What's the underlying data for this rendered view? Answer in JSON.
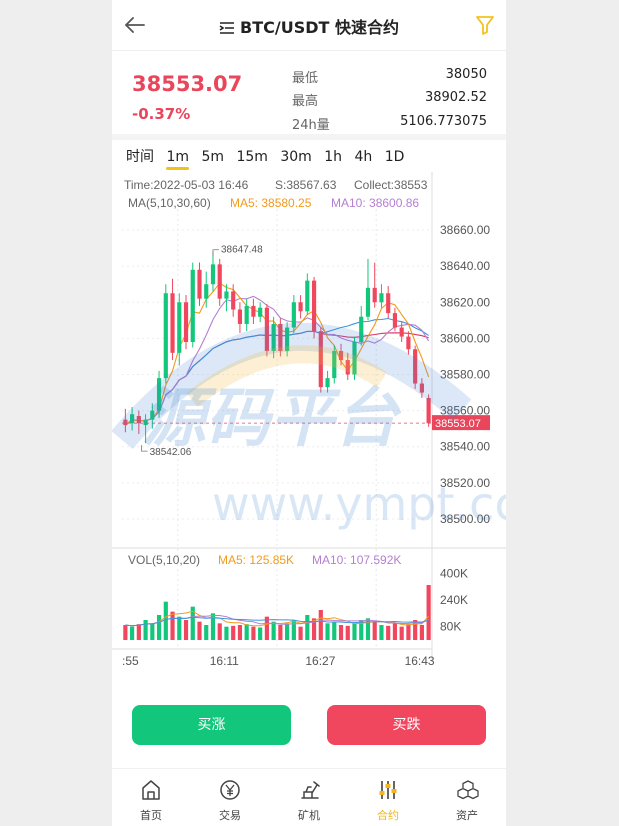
{
  "header": {
    "title": "BTC/USDT 快速合约"
  },
  "summary": {
    "price": "38553.07",
    "change": "-0.37%",
    "stats": [
      {
        "label": "最低",
        "value": "38050"
      },
      {
        "label": "最高",
        "value": "38902.52"
      },
      {
        "label": "24h量",
        "value": "5106.773075"
      }
    ]
  },
  "timeframes": [
    {
      "label": "时间",
      "active": false
    },
    {
      "label": "1m",
      "active": true
    },
    {
      "label": "5m",
      "active": false
    },
    {
      "label": "15m",
      "active": false
    },
    {
      "label": "30m",
      "active": false
    },
    {
      "label": "1h",
      "active": false
    },
    {
      "label": "4h",
      "active": false
    },
    {
      "label": "1D",
      "active": false
    }
  ],
  "chart_info": {
    "time": "Time:2022-05-03 16:46",
    "s": "S:38567.63",
    "collect": "Collect:38553",
    "ma_title": "MA(5,10,30,60)",
    "ma5": "MA5: 38580.25",
    "ma10": "MA10: 38600.86",
    "max_label": "38647.48",
    "min_label": "38542.06",
    "last_price": "38553.07",
    "vol_title": "VOL(5,10,20)",
    "vol_ma5": "MA5: 125.85K",
    "vol_ma10": "MA10: 107.592K"
  },
  "colors": {
    "up": "#12c77b",
    "down": "#f0475f",
    "ma5": "#f29a1c",
    "ma10": "#b57fd1",
    "ma30": "#3d95e0",
    "ma60": "#d63a6b",
    "accent": "#f2b51c"
  },
  "chart_data": {
    "type": "candlestick",
    "y_ticks": [
      "38660.00",
      "38640.00",
      "38620.00",
      "38600.00",
      "38580.00",
      "38560.00",
      "38540.00",
      "38520.00",
      "38500.00"
    ],
    "ylim": [
      38490,
      38670
    ],
    "vol_ticks": [
      "400K",
      "240K",
      "80K"
    ],
    "vol_lim": [
      0,
      420
    ],
    "x_ticks": [
      ":55",
      "16:11",
      "16:27",
      "16:43"
    ],
    "candles": [
      {
        "o": 38555,
        "c": 38552,
        "h": 38561,
        "l": 38548,
        "v": 90
      },
      {
        "o": 38553,
        "c": 38558,
        "h": 38562,
        "l": 38549,
        "v": 80
      },
      {
        "o": 38557,
        "c": 38553,
        "h": 38560,
        "l": 38547,
        "v": 95
      },
      {
        "o": 38552,
        "c": 38555,
        "h": 38558,
        "l": 38542,
        "v": 120
      },
      {
        "o": 38555,
        "c": 38560,
        "h": 38564,
        "l": 38550,
        "v": 100
      },
      {
        "o": 38560,
        "c": 38578,
        "h": 38582,
        "l": 38556,
        "v": 150
      },
      {
        "o": 38578,
        "c": 38625,
        "h": 38630,
        "l": 38575,
        "v": 230
      },
      {
        "o": 38625,
        "c": 38592,
        "h": 38633,
        "l": 38588,
        "v": 170
      },
      {
        "o": 38592,
        "c": 38620,
        "h": 38625,
        "l": 38585,
        "v": 140
      },
      {
        "o": 38620,
        "c": 38598,
        "h": 38624,
        "l": 38594,
        "v": 120
      },
      {
        "o": 38598,
        "c": 38638,
        "h": 38642,
        "l": 38595,
        "v": 200
      },
      {
        "o": 38638,
        "c": 38622,
        "h": 38642,
        "l": 38618,
        "v": 110
      },
      {
        "o": 38622,
        "c": 38630,
        "h": 38637,
        "l": 38617,
        "v": 90
      },
      {
        "o": 38630,
        "c": 38641,
        "h": 38648,
        "l": 38626,
        "v": 160
      },
      {
        "o": 38641,
        "c": 38622,
        "h": 38644,
        "l": 38618,
        "v": 100
      },
      {
        "o": 38622,
        "c": 38626,
        "h": 38630,
        "l": 38615,
        "v": 80
      },
      {
        "o": 38626,
        "c": 38616,
        "h": 38630,
        "l": 38612,
        "v": 85
      },
      {
        "o": 38616,
        "c": 38608,
        "h": 38620,
        "l": 38603,
        "v": 90
      },
      {
        "o": 38608,
        "c": 38618,
        "h": 38622,
        "l": 38604,
        "v": 95
      },
      {
        "o": 38618,
        "c": 38612,
        "h": 38622,
        "l": 38608,
        "v": 80
      },
      {
        "o": 38612,
        "c": 38617,
        "h": 38620,
        "l": 38609,
        "v": 75
      },
      {
        "o": 38617,
        "c": 38593,
        "h": 38619,
        "l": 38590,
        "v": 140
      },
      {
        "o": 38593,
        "c": 38608,
        "h": 38612,
        "l": 38589,
        "v": 110
      },
      {
        "o": 38608,
        "c": 38593,
        "h": 38611,
        "l": 38590,
        "v": 90
      },
      {
        "o": 38593,
        "c": 38606,
        "h": 38609,
        "l": 38590,
        "v": 100
      },
      {
        "o": 38606,
        "c": 38620,
        "h": 38624,
        "l": 38603,
        "v": 120
      },
      {
        "o": 38620,
        "c": 38615,
        "h": 38624,
        "l": 38611,
        "v": 80
      },
      {
        "o": 38615,
        "c": 38632,
        "h": 38636,
        "l": 38613,
        "v": 150
      },
      {
        "o": 38632,
        "c": 38604,
        "h": 38634,
        "l": 38600,
        "v": 130
      },
      {
        "o": 38604,
        "c": 38573,
        "h": 38606,
        "l": 38570,
        "v": 180
      },
      {
        "o": 38573,
        "c": 38578,
        "h": 38582,
        "l": 38570,
        "v": 100
      },
      {
        "o": 38578,
        "c": 38593,
        "h": 38596,
        "l": 38575,
        "v": 110
      },
      {
        "o": 38593,
        "c": 38588,
        "h": 38597,
        "l": 38585,
        "v": 90
      },
      {
        "o": 38588,
        "c": 38580,
        "h": 38592,
        "l": 38577,
        "v": 85
      },
      {
        "o": 38580,
        "c": 38598,
        "h": 38601,
        "l": 38577,
        "v": 100
      },
      {
        "o": 38598,
        "c": 38612,
        "h": 38618,
        "l": 38596,
        "v": 120
      },
      {
        "o": 38612,
        "c": 38628,
        "h": 38644,
        "l": 38610,
        "v": 130
      },
      {
        "o": 38628,
        "c": 38620,
        "h": 38642,
        "l": 38617,
        "v": 110
      },
      {
        "o": 38620,
        "c": 38625,
        "h": 38630,
        "l": 38617,
        "v": 90
      },
      {
        "o": 38625,
        "c": 38614,
        "h": 38629,
        "l": 38611,
        "v": 85
      },
      {
        "o": 38614,
        "c": 38606,
        "h": 38617,
        "l": 38604,
        "v": 100
      },
      {
        "o": 38606,
        "c": 38601,
        "h": 38609,
        "l": 38598,
        "v": 80
      },
      {
        "o": 38601,
        "c": 38594,
        "h": 38604,
        "l": 38591,
        "v": 95
      },
      {
        "o": 38594,
        "c": 38575,
        "h": 38596,
        "l": 38572,
        "v": 120
      },
      {
        "o": 38575,
        "c": 38570,
        "h": 38578,
        "l": 38567,
        "v": 90
      },
      {
        "o": 38567,
        "c": 38553,
        "h": 38569,
        "l": 38551,
        "v": 330
      }
    ]
  },
  "actions": {
    "buy": "买涨",
    "sell": "买跌"
  },
  "tabs": [
    {
      "label": "首页",
      "icon": "home-icon",
      "active": false
    },
    {
      "label": "交易",
      "icon": "yen-coin-icon",
      "active": false
    },
    {
      "label": "矿机",
      "icon": "mining-machine-icon",
      "active": false
    },
    {
      "label": "合约",
      "icon": "contract-sliders-icon",
      "active": true
    },
    {
      "label": "资产",
      "icon": "assets-cubes-icon",
      "active": false
    }
  ],
  "watermark": {
    "line1": "源码平台",
    "line2": "www.ympt.cc"
  }
}
